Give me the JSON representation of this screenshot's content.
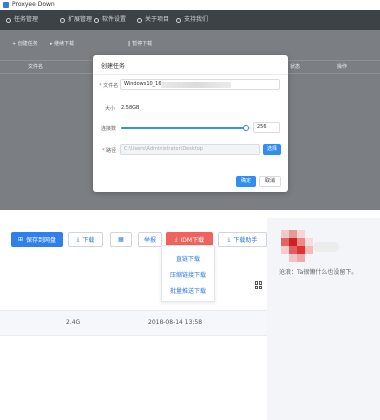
{
  "window": {
    "title": "Proxyee Down"
  },
  "topnav": {
    "items": [
      {
        "label": "任务管理"
      },
      {
        "label": "扩展管理"
      },
      {
        "label": "软件设置"
      },
      {
        "label": "关于项目"
      },
      {
        "label": "支持我们"
      }
    ]
  },
  "toolbar": {
    "items": [
      {
        "label": "创建任务"
      },
      {
        "label": "继续下载"
      },
      {
        "label": "暂停下载"
      }
    ]
  },
  "table": {
    "headers": [
      "文件名",
      "状态",
      "操作"
    ]
  },
  "dialog": {
    "title": "创建任务",
    "filename_label": "文件名",
    "filename_value": "Windows10_16",
    "size_label": "大小",
    "size_value": "2.58GB",
    "connections_label": "连接数",
    "connections_value": "256",
    "connections_fraction": 0.96,
    "path_label": "路径",
    "path_value": "C:\\Users\\Administrator\\Desktop",
    "choose_button": "选择",
    "confirm_button": "确定",
    "cancel_button": "取消"
  },
  "page": {
    "buttons": {
      "save_to_drive": "保存到网盘",
      "download": "下载",
      "share": "举报",
      "idm_download": "IDM下载",
      "download_helper": "下载助手"
    },
    "dropdown": {
      "items": [
        "直链下载",
        "压缩链接下载",
        "批量推送下载"
      ]
    },
    "file": {
      "size": "2.4G",
      "date": "2018-08-14 13:58"
    },
    "sidebar": {
      "ad_text": "沧浪：Ta很懒什么也没留下。"
    }
  },
  "colors": {
    "primary": "#2f80ed",
    "accent_red": "#f0625d",
    "nav_bg": "#3d4247",
    "overlay": "#7b7e82"
  }
}
